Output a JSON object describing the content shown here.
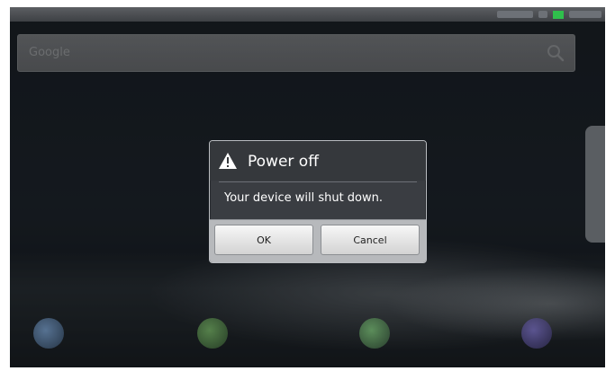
{
  "dialog": {
    "title": "Power off",
    "message": "Your device will shut down.",
    "ok_label": "OK",
    "cancel_label": "Cancel",
    "icon": "warning-icon"
  },
  "search": {
    "placeholder": "Google",
    "icon": "search-icon"
  },
  "colors": {
    "dialog_bg": "#3a3d42",
    "button_bar_bg": "#b7b9bc",
    "battery": "#2fbf4c"
  }
}
